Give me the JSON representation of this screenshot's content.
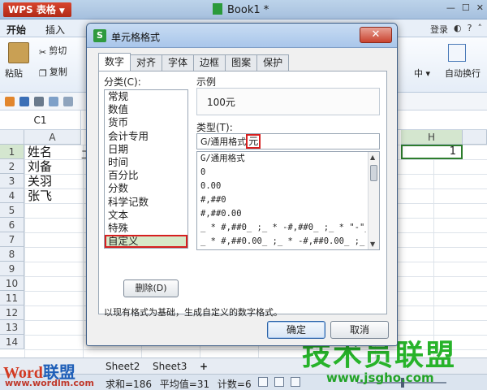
{
  "app": {
    "logo_text": "WPS 表格",
    "doc_title": "Book1 *"
  },
  "menu": {
    "start": "开始",
    "insert": "插入",
    "login": "登录"
  },
  "ribbon": {
    "paste": "粘贴",
    "cut": "剪切",
    "copy": "复制",
    "center": "中",
    "wrap": "自动换行"
  },
  "formula": {
    "cell_ref": "C1"
  },
  "grid": {
    "col_a": "A",
    "col_h": "H",
    "rows": [
      "1",
      "2",
      "3",
      "4",
      "5",
      "6",
      "7",
      "8",
      "9",
      "10",
      "11",
      "12",
      "13",
      "14"
    ],
    "names": [
      "姓名",
      "刘备",
      "关羽",
      "张飞"
    ],
    "h1_value": "1",
    "b1_fragment": "工"
  },
  "sheets": {
    "tab2": "Sheet2",
    "tab3": "Sheet3",
    "add": "+"
  },
  "status": {
    "text": "求和=186 平均值=31 计数=6"
  },
  "dialog": {
    "icon": "S",
    "title": "单元格格式",
    "close": "✕",
    "tabs": [
      "数字",
      "对齐",
      "字体",
      "边框",
      "图案",
      "保护"
    ],
    "category_label": "分类(C):",
    "categories": [
      "常规",
      "数值",
      "货币",
      "会计专用",
      "日期",
      "时间",
      "百分比",
      "分数",
      "科学记数",
      "文本",
      "特殊",
      "自定义"
    ],
    "selected_category": "自定义",
    "sample_label": "示例",
    "sample_value": "100元",
    "type_label": "类型(T):",
    "type_value_prefix": "G/通用格式",
    "type_value_suffix": "元",
    "formats": [
      "G/通用格式",
      "0",
      "0.00",
      "#,##0",
      "#,##0.00",
      "_ * #,##0_ ;_ * -#,##0_ ;_ * \"-\"_",
      "_ * #,##0.00_ ;_ * -#,##0.00_ ;_ * \""
    ],
    "delete_button": "删除(D)",
    "description": "以现有格式为基础，生成自定义的数字格式。",
    "ok": "确定",
    "cancel": "取消"
  },
  "watermarks": {
    "logo_word": "Word",
    "logo_union": "联盟",
    "logo_url": "www.wordlm.com",
    "right_cn": "技术员联盟",
    "right_url": "www.jsgho.com"
  },
  "colors": {
    "dialog_selection": "#d6e8c8",
    "highlight_red": "#d61f1f",
    "cell_selection": "#2d7d2d"
  }
}
